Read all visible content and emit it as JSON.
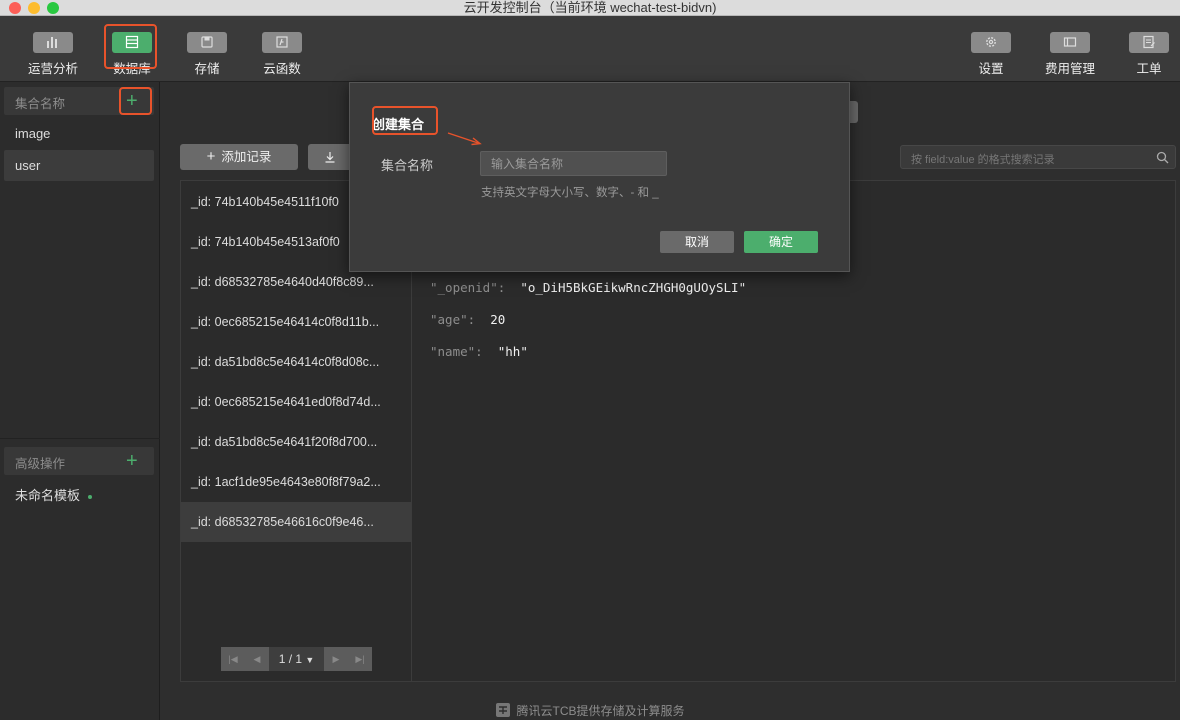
{
  "window": {
    "title": "云开发控制台（当前环境 wechat-test-bidvn)"
  },
  "toolbar": {
    "items": [
      {
        "label": "运营分析",
        "icon": "bar-chart-icon"
      },
      {
        "label": "数据库",
        "icon": "database-icon",
        "active": true
      },
      {
        "label": "存储",
        "icon": "storage-icon"
      },
      {
        "label": "云函数",
        "icon": "function-icon"
      }
    ],
    "right_items": [
      {
        "label": "设置",
        "icon": "gear-icon"
      },
      {
        "label": "费用管理",
        "icon": "billing-icon"
      },
      {
        "label": "工单",
        "icon": "ticket-icon"
      }
    ]
  },
  "sidebar": {
    "collections_header": "集合名称",
    "collections": [
      "image",
      "user"
    ],
    "advanced_header": "高级操作",
    "templates": [
      "未命名模板"
    ]
  },
  "main": {
    "add_record_label": "添加记录",
    "search_placeholder": "按 field:value 的格式搜索记录",
    "records": [
      "_id: 74b140b45e4511f10f0",
      "_id: 74b140b45e4513af0f0",
      "_id: d68532785e4640d40f8c89...",
      "_id: 0ec685215e46414c0f8d11b...",
      "_id: da51bd8c5e46414c0f8d08c...",
      "_id: 0ec685215e4641ed0f8d74d...",
      "_id: da51bd8c5e4641f20f8d700...",
      "_id: 1acf1de95e4643e80f8f79a2...",
      "_id: d68532785e46616c0f9e46..."
    ],
    "pager": {
      "text": "1 / 1"
    },
    "detail": [
      {
        "key": "\"_openid\":",
        "value": "\"o_DiH5BkGEikwRncZHGH0gUOySLI\""
      },
      {
        "key": "\"age\":",
        "value": "20"
      },
      {
        "key": "\"name\":",
        "value": "\"hh\""
      }
    ]
  },
  "modal": {
    "title": "创建集合",
    "label": "集合名称",
    "input_placeholder": "输入集合名称",
    "hint": "支持英文字母大小写、数字、- 和 _",
    "cancel": "取消",
    "confirm": "确定"
  },
  "footer": {
    "text": "腾讯云TCB提供存储及计算服务"
  },
  "colors": {
    "accent": "#4cae6d",
    "highlight": "#e8532b"
  }
}
